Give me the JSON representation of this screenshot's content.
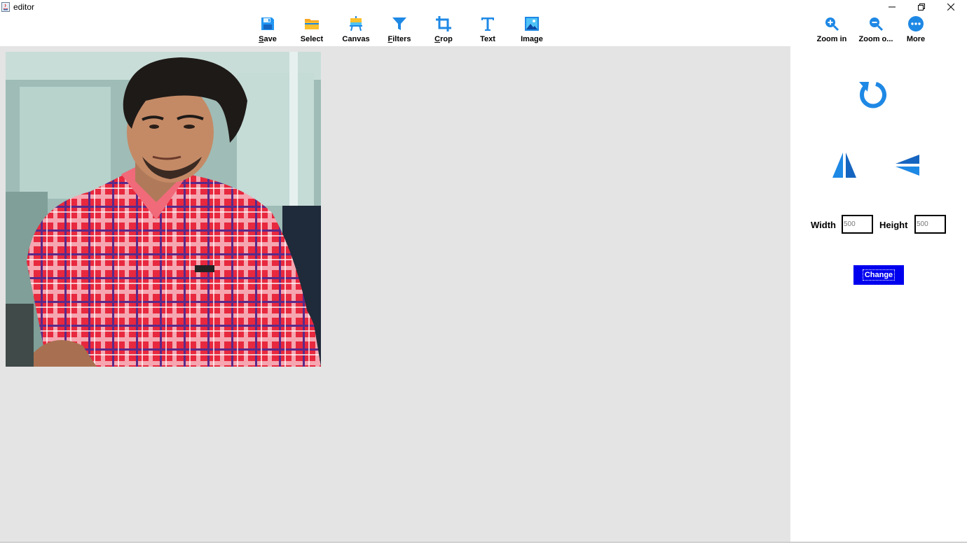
{
  "window": {
    "title": "editor",
    "controls": {
      "minimize": "minimize-icon",
      "maximize": "restore-icon",
      "close": "close-icon"
    }
  },
  "toolbar": {
    "items": [
      {
        "label": "Save",
        "icon": "save-icon",
        "mnemonic": true
      },
      {
        "label": "Select",
        "icon": "folder-icon",
        "mnemonic": false
      },
      {
        "label": "Canvas",
        "icon": "easel-icon",
        "mnemonic": false
      },
      {
        "label": "Filters",
        "icon": "filter-icon",
        "mnemonic": true
      },
      {
        "label": "Crop",
        "icon": "crop-icon",
        "mnemonic": true
      },
      {
        "label": "Text",
        "icon": "text-icon",
        "mnemonic": false
      },
      {
        "label": "Image",
        "icon": "image-icon",
        "mnemonic": false
      }
    ],
    "right_items": [
      {
        "label": "Zoom in",
        "icon": "zoom-in-icon"
      },
      {
        "label": "Zoom o...",
        "icon": "zoom-out-icon"
      },
      {
        "label": "More",
        "icon": "more-icon"
      }
    ]
  },
  "side_panel": {
    "rotate_icon": "rotate-icon",
    "flip_horizontal_icon": "flip-horizontal-icon",
    "flip_vertical_icon": "flip-vertical-icon",
    "width_label": "Width",
    "width_value": "500",
    "height_label": "Height",
    "height_value": "500",
    "change_label": "Change"
  },
  "colors": {
    "accent_blue": "#1e88e5",
    "change_button": "#0000ee",
    "canvas_background": "#e4e4e4"
  }
}
